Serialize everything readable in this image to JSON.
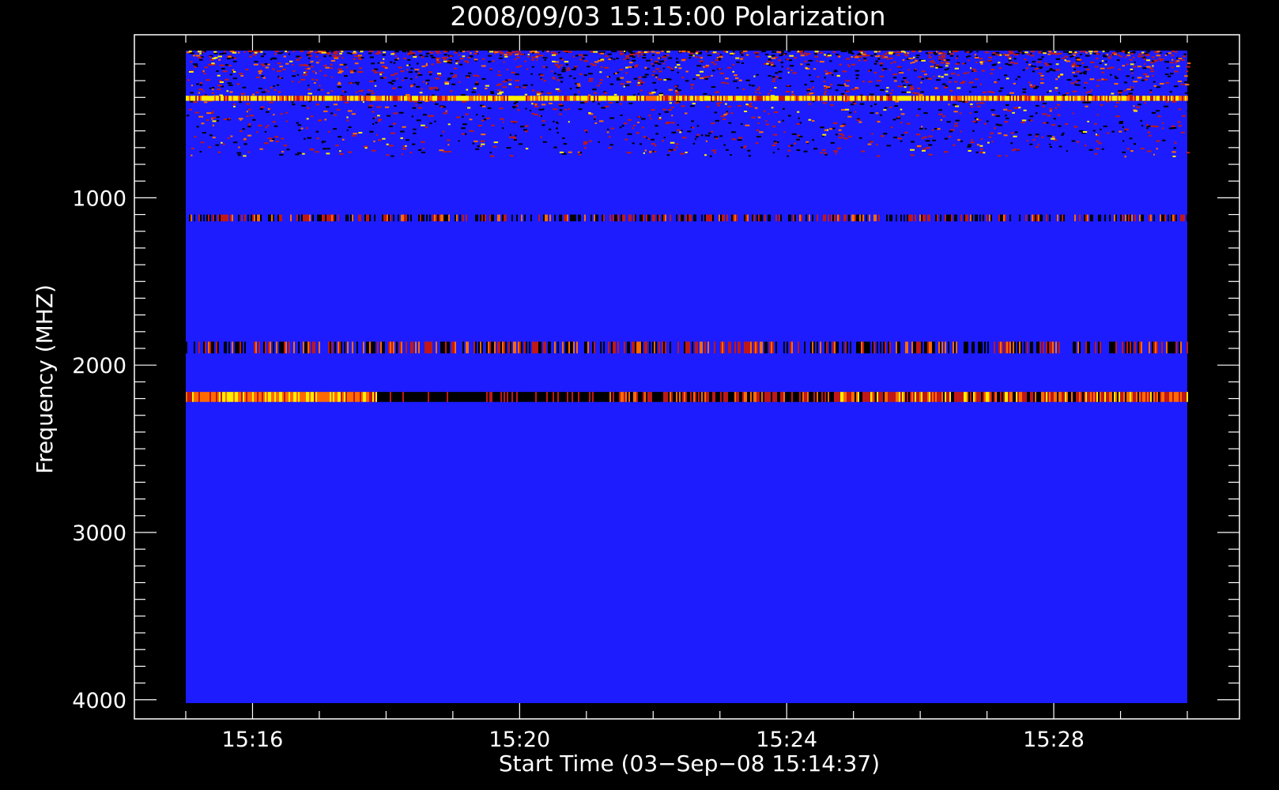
{
  "chart_data": {
    "type": "heatmap",
    "title": "2008/09/03 15:15:00 Polarization",
    "xlabel": "Start Time (03−Sep−08 15:14:37)",
    "ylabel": "Frequency (MHZ)",
    "x_range": [
      "15:15:00",
      "15:30:00"
    ],
    "y_range": [
      120,
      4020
    ],
    "y_reversed": true,
    "x_ticks": [
      {
        "value": "15:16",
        "minutes": 16
      },
      {
        "value": "15:20",
        "minutes": 20
      },
      {
        "value": "15:24",
        "minutes": 24
      },
      {
        "value": "15:28",
        "minutes": 28
      }
    ],
    "y_ticks": [
      1000,
      2000,
      3000,
      4000
    ],
    "x_minor_step_minutes": 1,
    "y_minor_step": 100,
    "grid": false,
    "colormap": [
      "#000000",
      "#1c1cff",
      "#c01818",
      "#ff6a00",
      "#ffee00"
    ],
    "background_color": "#1c1cff",
    "features": [
      {
        "name": "rfi-low-band",
        "freq_range": [
          120,
          750
        ]
      },
      {
        "name": "band-400",
        "freq_range": [
          390,
          420
        ]
      },
      {
        "name": "band-1120",
        "freq_range": [
          1100,
          1140
        ]
      },
      {
        "name": "band-1900",
        "freq_range": [
          1860,
          1930
        ]
      },
      {
        "name": "band-2180",
        "freq_range": [
          2160,
          2220
        ]
      }
    ]
  }
}
